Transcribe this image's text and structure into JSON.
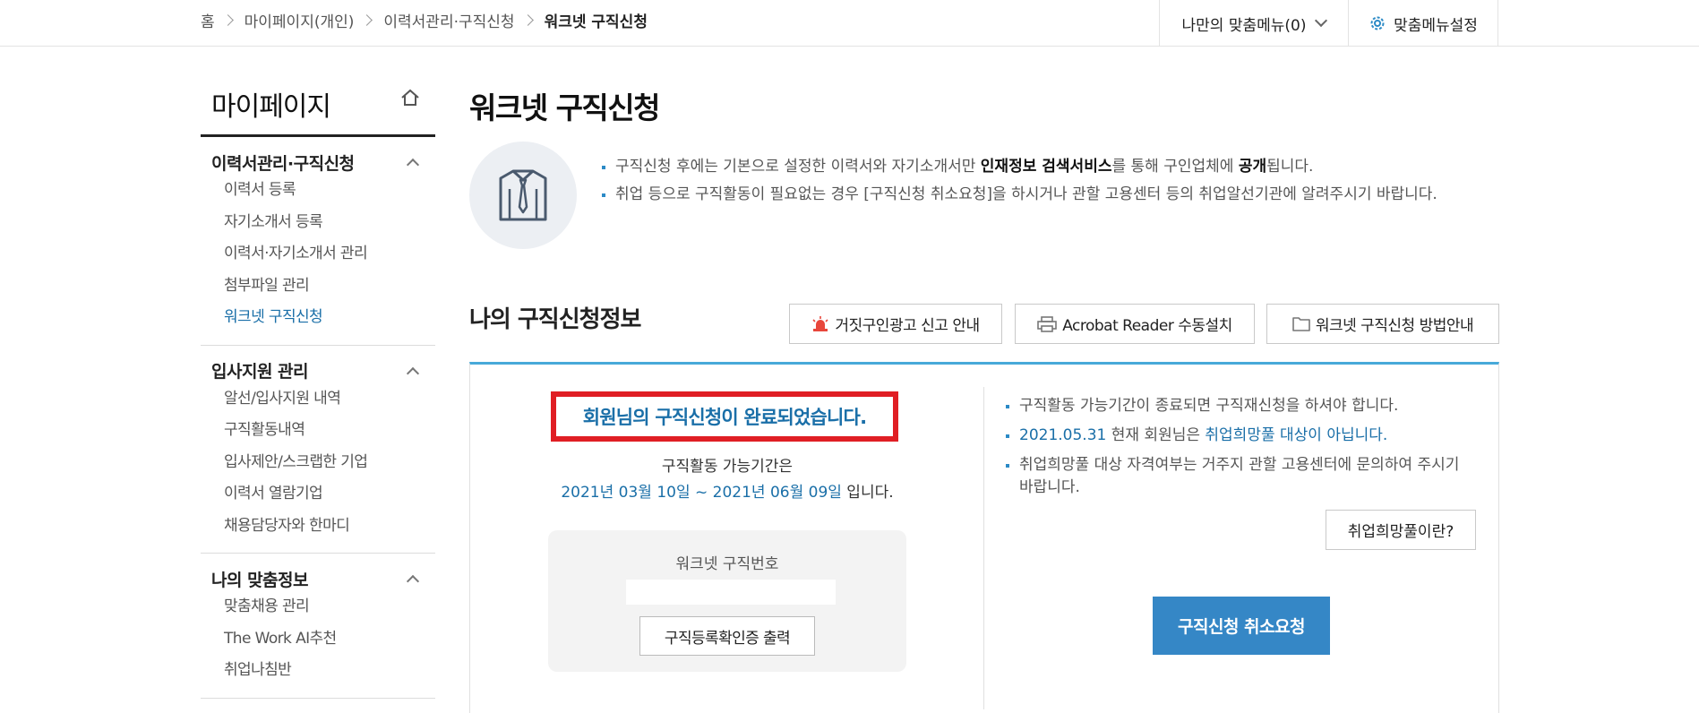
{
  "breadcrumb": {
    "home": "홈",
    "level1": "마이페이지(개인)",
    "level2": "이력서관리·구직신청",
    "current": "워크넷 구직신청"
  },
  "header": {
    "my_menu_label": "나만의 맞춤메뉴(0)",
    "menu_settings_label": "맞춤메뉴설정"
  },
  "sidebar": {
    "title": "마이페이지",
    "groups": [
      {
        "title": "이력서관리·구직신청",
        "items": [
          "이력서 등록",
          "자기소개서 등록",
          "이력서·자기소개서 관리",
          "첨부파일 관리",
          "워크넷 구직신청"
        ]
      },
      {
        "title": "입사지원 관리",
        "items": [
          "알선/입사지원 내역",
          "구직활동내역",
          "입사제안/스크랩한 기업",
          "이력서 열람기업",
          "채용담당자와 한마디"
        ]
      },
      {
        "title": "나의 맞춤정보",
        "items": [
          "맞춤채용 관리",
          "The Work AI추천",
          "취업나침반"
        ]
      }
    ]
  },
  "main": {
    "title": "워크넷 구직신청",
    "notice": {
      "line1_pre": "구직신청 후에는 기본으로 설정한 이력서와 자기소개서만 ",
      "line1_bold1": "인재정보 검색서비스",
      "line1_mid": "를 통해 구인업체에 ",
      "line1_bold2": "공개",
      "line1_post": "됩니다.",
      "line2": "취업 등으로 구직활동이 필요없는 경우 [구직신청 취소요청]을 하시거나 관할 고용센터 등의 취업알선기관에 알려주시기 바랍니다."
    },
    "section_title": "나의 구직신청정보",
    "buttons": {
      "fake_ad": "거짓구인광고 신고 안내",
      "acrobat": "Acrobat Reader 수동설치",
      "guide": "워크넷 구직신청 방법안내"
    },
    "status": {
      "done_message": "회원님의 구직신청이 완료되었습니다.",
      "period_label": "구직활동 가능기간은",
      "period_dates": "2021년 03월 10일 ~ 2021년 06월 09일",
      "period_suffix": " 입니다.",
      "reg_number_label": "워크넷 구직번호",
      "reg_number_value": "",
      "print_button": "구직등록확인증 출력"
    },
    "right_notes": {
      "note1": "구직활동 가능기간이 종료되면 구직재신청을 하셔야 합니다.",
      "note2_date": "2021.05.31",
      "note2_mid": " 현재 회원님은 ",
      "note2_status": "취업희망풀 대상이 아닙니다.",
      "note3": "취업희망풀 대상 자격여부는 거주지 관할 고용센터에 문의하여 주시기 바랍니다.",
      "whatis_button": "취업희망풀이란?",
      "cancel_button": "구직신청 취소요청"
    }
  },
  "icons": {
    "home": "home-icon",
    "settings": "gear-icon",
    "shirt": "shirt-icon",
    "siren": "siren-icon",
    "printer": "printer-icon",
    "folder": "folder-icon"
  },
  "colors": {
    "accent_blue": "#1a6fa8",
    "button_blue": "#3587c6",
    "highlight_red": "#e01e24",
    "section_border": "#47a9d9"
  }
}
